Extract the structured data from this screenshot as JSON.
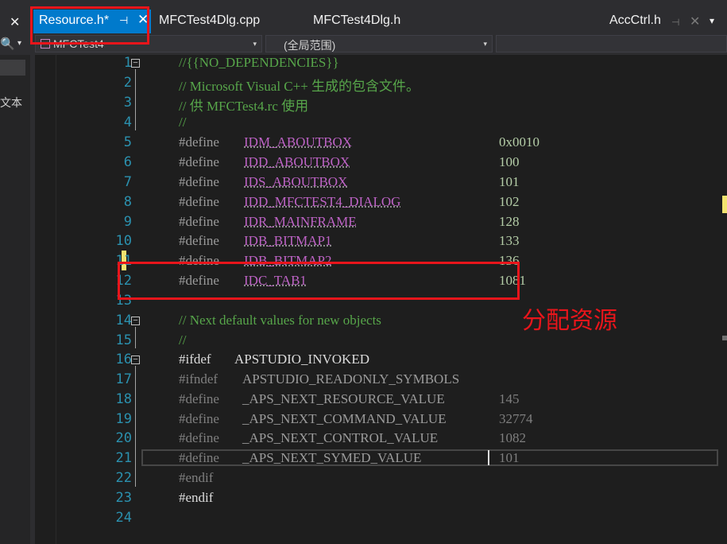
{
  "tabs": {
    "left_close": "✕",
    "active": {
      "label": "Resource.h*",
      "pin": "⊣",
      "close": "✕"
    },
    "others": [
      "MFCTest4Dlg.cpp",
      "MFCTest4Dlg.h"
    ],
    "right": {
      "label": "AccCtrl.h",
      "pin": "⊣",
      "close": "✕",
      "dropdown": "▾"
    }
  },
  "nav": {
    "search_icon": "🔍",
    "search_dropdown": "▾",
    "project_combo": "MFCTest4",
    "scope_combo": "(全局范围)",
    "member_combo": "",
    "dropdown_glyph": "▾"
  },
  "leftpanel": {
    "partial_text": "文本"
  },
  "code_lines": [
    {
      "n": "1",
      "text": "//{{NO_DEPENDENCIES}}"
    },
    {
      "n": "2",
      "text": "// Microsoft Visual C++ 生成的包含文件。"
    },
    {
      "n": "3",
      "text": "// 供 MFCTest4.rc 使用"
    },
    {
      "n": "4",
      "text": "//"
    },
    {
      "n": "5",
      "kw": "#define",
      "name": "IDM_ABOUTBOX",
      "val": "0x0010"
    },
    {
      "n": "6",
      "kw": "#define",
      "name": "IDD_ABOUTBOX",
      "val": "100"
    },
    {
      "n": "7",
      "kw": "#define",
      "name": "IDS_ABOUTBOX",
      "val": "101"
    },
    {
      "n": "8",
      "kw": "#define",
      "name": "IDD_MFCTEST4_DIALOG",
      "val": "102"
    },
    {
      "n": "9",
      "kw": "#define",
      "name": "IDR_MAINFRAME",
      "val": "128"
    },
    {
      "n": "10",
      "kw": "#define",
      "name": "IDB_BITMAP1",
      "val": "133"
    },
    {
      "n": "11",
      "kw": "#define",
      "name": "IDB_BITMAP2",
      "val": "136"
    },
    {
      "n": "12",
      "kw": "#define",
      "name": "IDC_TAB1",
      "val": "1081"
    },
    {
      "n": "13",
      "text": ""
    },
    {
      "n": "14",
      "text": "// Next default values for new objects"
    },
    {
      "n": "15",
      "text": "//"
    },
    {
      "n": "16",
      "kw": "#ifdef",
      "name": "APSTUDIO_INVOKED"
    },
    {
      "n": "17",
      "kw": "#ifndef",
      "name": "APSTUDIO_READONLY_SYMBOLS"
    },
    {
      "n": "18",
      "kw": "#define",
      "name": "_APS_NEXT_RESOURCE_VALUE",
      "val": "145"
    },
    {
      "n": "19",
      "kw": "#define",
      "name": "_APS_NEXT_COMMAND_VALUE",
      "val": "32774"
    },
    {
      "n": "20",
      "kw": "#define",
      "name": "_APS_NEXT_CONTROL_VALUE",
      "val": "1082"
    },
    {
      "n": "21",
      "kw": "#define",
      "name": "_APS_NEXT_SYMED_VALUE",
      "val": "101"
    },
    {
      "n": "22",
      "kw": "#endif"
    },
    {
      "n": "23",
      "kw": "#endif"
    },
    {
      "n": "24",
      "text": ""
    }
  ],
  "annotation": "分配资源",
  "colors": {
    "accent": "#007acc",
    "highlight": "#e8151b",
    "comment": "#57a64a",
    "line_number": "#2b91af",
    "macro": "#bd63c5",
    "number": "#b5cea8"
  }
}
